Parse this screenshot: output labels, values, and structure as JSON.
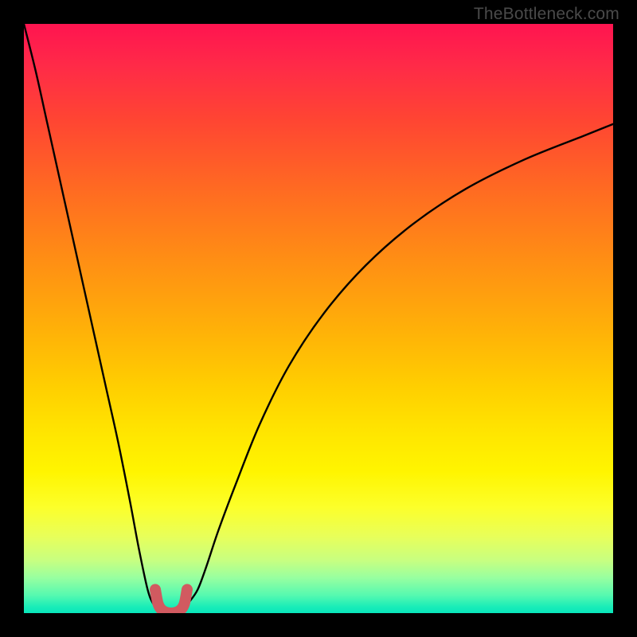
{
  "watermark": "TheBottleneck.com",
  "colors": {
    "frame": "#000000",
    "curve": "#000000",
    "highlight_stroke": "#d15a60",
    "gradient_top": "#ff1450",
    "gradient_bottom": "#08e6bb"
  },
  "chart_data": {
    "type": "line",
    "title": "",
    "xlabel": "",
    "ylabel": "",
    "xlim": [
      0,
      100
    ],
    "ylim": [
      0,
      100
    ],
    "grid": false,
    "series": [
      {
        "name": "left-branch",
        "x": [
          0,
          2,
          4,
          6,
          8,
          10,
          12,
          14,
          16,
          18,
          19.5,
          21,
          22,
          23
        ],
        "y": [
          100,
          92,
          83,
          74,
          65,
          56,
          47,
          38,
          29,
          19,
          11,
          4,
          1.5,
          0.5
        ]
      },
      {
        "name": "right-branch",
        "x": [
          27,
          28,
          29.5,
          31,
          33,
          36,
          40,
          45,
          51,
          58,
          66,
          75,
          85,
          95,
          100
        ],
        "y": [
          0.5,
          1.8,
          4,
          8,
          14,
          22,
          32,
          42,
          51,
          59,
          66,
          72,
          77,
          81,
          83
        ]
      }
    ],
    "highlight": {
      "name": "valley-marker",
      "x": [
        22.3,
        22.8,
        23.6,
        25.0,
        26.4,
        27.2,
        27.7
      ],
      "y": [
        4.0,
        1.5,
        0.4,
        0.0,
        0.4,
        1.5,
        4.0
      ]
    }
  }
}
